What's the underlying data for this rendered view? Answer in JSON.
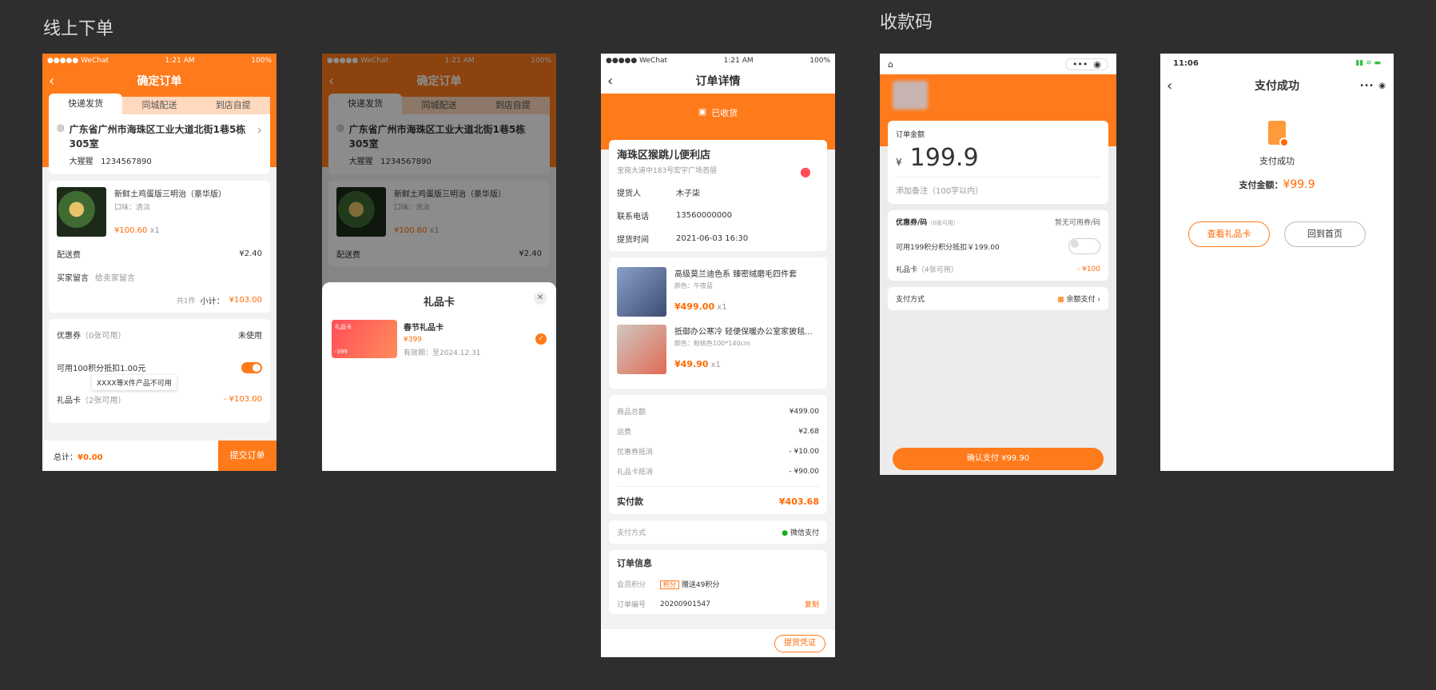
{
  "sections": {
    "online": "线上下单",
    "payment_code": "收款码"
  },
  "status": {
    "carrier": "●●●●● WeChat",
    "time": "1:21 AM",
    "battery": "100%",
    "time2": "11:06"
  },
  "s1": {
    "title": "确定订单",
    "tabs": [
      "快递发货",
      "同城配送",
      "到店自提"
    ],
    "address": "广东省广州市海珠区工业大道北街1巷5栋305室",
    "contact_name": "大猩猩",
    "contact_phone": "1234567890",
    "product": {
      "name": "新鲜土鸡蛋版三明治（豪华版）",
      "flavor": "口味：清淡",
      "price": "¥100.60",
      "qty": "x1"
    },
    "shipping_label": "配送费",
    "shipping_value": "¥2.40",
    "note_label": "买家留言",
    "note_placeholder": "给卖家留言",
    "count": "共1件",
    "subtotal_label": "小计：",
    "subtotal": "¥103.00",
    "coupon_label": "优惠券",
    "coupon_count": "（0张可用）",
    "coupon_value": "未使用",
    "points": "可用100积分抵扣1.00元",
    "tooltip": "XXXX等X件产品不可用",
    "giftcard_label": "礼品卡",
    "giftcard_count": "（2张可用）",
    "giftcard_value": "- ¥103.00",
    "total_label": "总计：",
    "total": "¥0.00",
    "submit": "提交订单"
  },
  "s2": {
    "sheet_title": "礼品卡",
    "card_name": "春节礼品卡",
    "card_amount": "¥399",
    "card_expiry": "有效期：至2024.12.31",
    "card_thumb_label": "礼品卡",
    "card_thumb_value": "-399"
  },
  "s3": {
    "title": "订单详情",
    "status": "已收货",
    "store": "海珠区猴跳儿便利店",
    "store_addr": "宝岗大道中183号宏宇广场首层",
    "info": [
      {
        "k": "提货人",
        "v": "木子柒"
      },
      {
        "k": "联系电话",
        "v": "13560000000"
      },
      {
        "k": "提货时间",
        "v": "2021-06-03 16:30"
      }
    ],
    "items": [
      {
        "name": "高级莫兰迪色系 臻密绒磨毛四件套",
        "spec": "颜色：午夜蓝",
        "price": "¥499.00",
        "qty": "x1"
      },
      {
        "name": "抵御办公寒冷 轻便保暖办公室家披毯...",
        "spec": "颜色：粉桃色100*140cm",
        "price": "¥49.90",
        "qty": "x1"
      }
    ],
    "sums": [
      {
        "k": "商品总额",
        "v": "¥499.00"
      },
      {
        "k": "运费",
        "v": "¥2.68"
      },
      {
        "k": "优惠券抵消",
        "v": "- ¥10.00"
      },
      {
        "k": "礼品卡抵消",
        "v": "- ¥90.00"
      }
    ],
    "paid_label": "实付款",
    "paid": "¥403.68",
    "pay_label": "支付方式",
    "pay_value": "微信支付",
    "order_info": "订单信息",
    "points_label": "会员积分",
    "points_tag": "积分",
    "points_value": "赠送49积分",
    "order_no_label": "订单编号",
    "order_no": "20200901547",
    "copy": "复制",
    "voucher": "提货凭证"
  },
  "s4": {
    "amount_label": "订单金额",
    "currency": "¥",
    "amount": "199.9",
    "remark": "添加备注（100字以内）",
    "coupon_label": "优惠券/码",
    "coupon_sub": "（0张可用）",
    "coupon_value": "暂无可用券/码",
    "points": "可用199积分积分抵扣￥199.00",
    "giftcard_label": "礼品卡",
    "giftcard_sub": "（4张可用）",
    "giftcard_value": "- ¥100",
    "pay_label": "支付方式",
    "pay_value": "余额支付",
    "confirm": "确认支付 ¥99.90"
  },
  "s5": {
    "title": "支付成功",
    "status": "支付成功",
    "amount_label": "支付金额：",
    "amount": "¥99.9",
    "btn_gift": "查看礼品卡",
    "btn_home": "回到首页"
  }
}
